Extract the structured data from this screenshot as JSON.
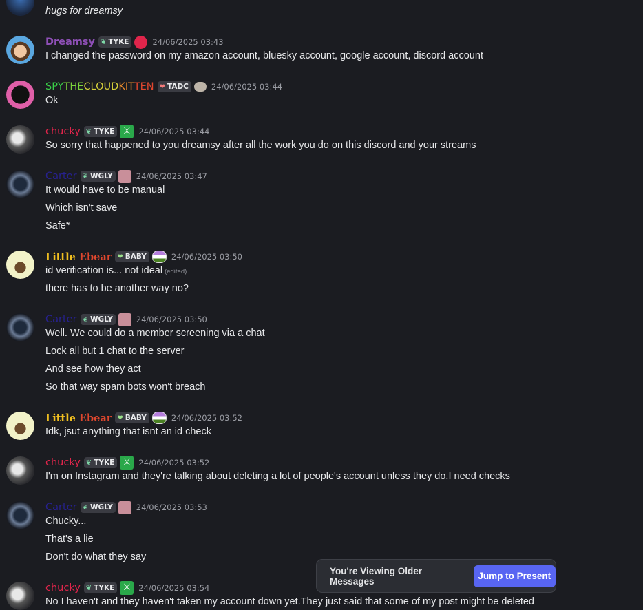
{
  "colors": {
    "background": "#1b1c21",
    "jump_button": "#5865f2",
    "dreamsy": "#8e4fb6",
    "chucky": "#e0254b",
    "carter": "#27218f",
    "ebear_a": "#f2c020",
    "ebear_b": "#e0472e"
  },
  "messages": [
    {
      "user": "Dreamsy",
      "tag": "TYKE",
      "time": "24/06/2025 03:43",
      "lines": [
        "I changed the password on my amazon account, bluesky account, google account, discord account"
      ]
    },
    {
      "user_parts": [
        "SPY",
        "THE",
        "CLOUD",
        "KIT",
        "TEN"
      ],
      "tag": "TADC",
      "time": "24/06/2025 03:44",
      "lines": [
        "Ok"
      ]
    },
    {
      "user": "chucky",
      "tag": "TYKE",
      "time": "24/06/2025 03:44",
      "lines": [
        "So sorry  that happened  to you dreamsy  after all the work you do on this  discord and your streams"
      ]
    },
    {
      "user": "Carter",
      "tag": "WGLY",
      "time": "24/06/2025 03:47",
      "lines": [
        "It would have to be manual",
        "Which isn't save",
        "Safe*"
      ]
    },
    {
      "user_a": "Little",
      "user_b": "Ebear",
      "tag": "BABY",
      "time": "24/06/2025 03:50",
      "lines": [
        "id verification is... not ideal",
        "there has to be another way no?"
      ],
      "edited": "(edited)"
    },
    {
      "user": "Carter",
      "tag": "WGLY",
      "time": "24/06/2025 03:50",
      "lines": [
        "Well. We could do a member screening via a chat",
        "Lock all but 1 chat to the server",
        "And see how they act",
        "So that way spam bots won't breach"
      ]
    },
    {
      "user_a": "Little",
      "user_b": "Ebear",
      "tag": "BABY",
      "time": "24/06/2025 03:52",
      "lines": [
        "Idk, jsut anything that isnt an id check"
      ]
    },
    {
      "user": "chucky",
      "tag": "TYKE",
      "time": "24/06/2025 03:52",
      "lines": [
        "I'm on Instagram and they're talking about deleting a lot of people's account unless they do.I need checks"
      ]
    },
    {
      "user": "Carter",
      "tag": "WGLY",
      "time": "24/06/2025 03:53",
      "lines": [
        "Chucky...",
        "That's a lie",
        "Don't do what they say"
      ]
    },
    {
      "user": "chucky",
      "tag": "TYKE",
      "time": "24/06/2025 03:54",
      "lines": [
        "No I haven't and they haven't taken my account down yet.They just said that some of my post might be deleted"
      ]
    }
  ],
  "top_partial": {
    "line": "hugs for dreamsy"
  },
  "banner": {
    "text": "You're Viewing Older Messages",
    "button": "Jump to Present"
  }
}
